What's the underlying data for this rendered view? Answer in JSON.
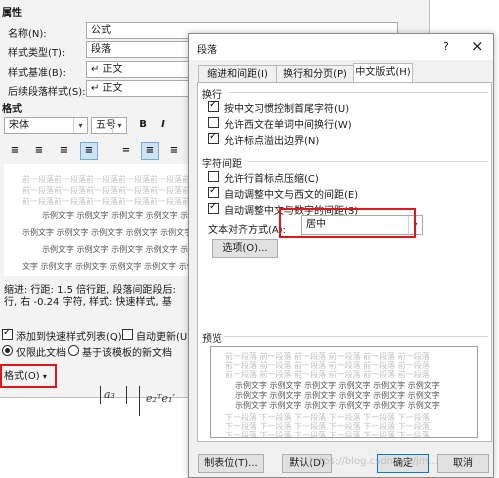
{
  "bg": {
    "section_property": "属性",
    "name_label": "名称(N):",
    "name_value": "公式",
    "type_label": "样式类型(T):",
    "type_value": "段落",
    "base_label": "样式基准(B):",
    "base_value": "↵ 正文",
    "next_label": "后续段落样式(S):",
    "next_value": "↵ 正文",
    "section_format": "格式",
    "font_value": "宋体",
    "size_value": "五号",
    "bold": "B",
    "italic": "I",
    "preview_prev": "前一段落前一段落前一段落前一段落前一段落前一段落前一段落前一段落前一段落前一段落前一段落前一段落前一段落",
    "preview_sample": [
      "示例文字 示例文字 示例文字 示例文字 示例文字",
      "示例文字 示例文字 示例文字 示例文字 示例文字 示例文字 示例文字",
      "示例文字 示例文字 示例文字 示例文字 示例文字",
      "文字 示例文字 示例文字 示例文字 示例文字 示例文字 示例文字 示例"
    ],
    "desc_line1": "缩进: 行距: 1.5 倍行距, 段落间距段后:",
    "desc_line2": "行, 右 -0.24 字符, 样式: 快速样式, 基",
    "add_quick": "添加到快速样式列表(Q)",
    "auto_update": "自动更新(U)",
    "only_doc": "仅限此文档",
    "new_template": "基于该模板的新文档",
    "format_btn": "格式(O)",
    "math1": "a₃",
    "math2": "e₂ᵀe₁′"
  },
  "dialog": {
    "title": "段落",
    "help": "?",
    "close": "×",
    "tabs": [
      "缩进和间距(I)",
      "换行和分页(P)",
      "中文版式(H)"
    ],
    "active_tab": 2,
    "line_break_title": "换行",
    "opt_rules": "按中文习惯控制首尾字符(U)",
    "opt_wordwrap": "允许西文在单词中间换行(W)",
    "opt_hanging": "允许标点溢出边界(N)",
    "char_spacing_title": "字符间距",
    "opt_compress": "允许行首标点压缩(C)",
    "opt_auto_western": "自动调整中文与西文的间距(E)",
    "opt_auto_number": "自动调整中文与数字的间距(S)",
    "align_label": "文本对齐方式(A):",
    "align_value": "居中",
    "options_btn": "选项(O)...",
    "preview_title": "预览",
    "preview_gray1": "前一段落 前一段落 前一段落 前一段落 前一段落 前一段落",
    "preview_dark": "示例文字 示例文字 示例文字 示例文字 示例文字 示例文字",
    "preview_gray2": "下一段落 下一段落 下一段落 下一段落 下一段落 下一段落",
    "tabs_btn": "制表位(T)...",
    "default_btn": "默认(D)",
    "ok_btn": "确定",
    "cancel_btn": "取消",
    "watermark": "https://blog.csdn.net/jm..."
  },
  "checks": {
    "opt_rules": true,
    "opt_wordwrap": false,
    "opt_hanging": true,
    "opt_compress": false,
    "opt_auto_western": true,
    "opt_auto_number": true,
    "add_quick": true,
    "auto_update": false
  },
  "colors": {
    "highlight": "#e0161a",
    "accent": "#0078d7"
  }
}
